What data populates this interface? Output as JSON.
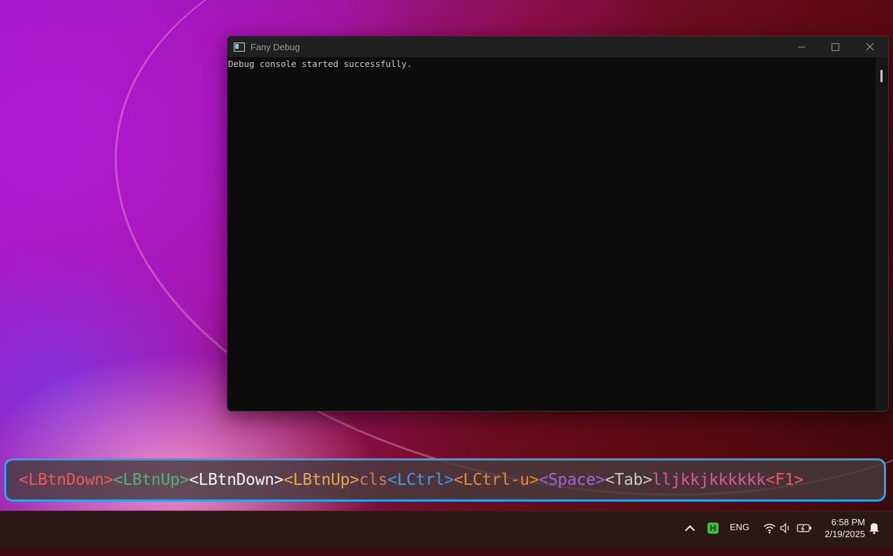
{
  "window": {
    "title": "Fany Debug",
    "console_lines": [
      "Debug console started successfully."
    ],
    "icons": {
      "minimize": "minimize-icon",
      "maximize": "maximize-icon",
      "close": "close-icon"
    }
  },
  "key_overlay": {
    "border_color": "#2aa6e6",
    "segments": [
      {
        "text": "<LBtnDown>",
        "color": "#e85a5a"
      },
      {
        "text": "<LBtnUp>",
        "color": "#52b07a"
      },
      {
        "text": "<LBtnDown>",
        "color": "#f2f2f2"
      },
      {
        "text": "<LBtnUp>",
        "color": "#e6a84a"
      },
      {
        "text": "cls",
        "color": "#d07a52"
      },
      {
        "text": "<LCtrl>",
        "color": "#3a9ee6"
      },
      {
        "text": "<LCtrl-u>",
        "color": "#e08a40"
      },
      {
        "text": "<Space>",
        "color": "#a066e0"
      },
      {
        "text": "<Tab>",
        "color": "#c8c8c8"
      },
      {
        "text": "lljkkjkkkkkk",
        "color": "#d85aa0"
      },
      {
        "text": "<F1>",
        "color": "#e85a5a"
      }
    ]
  },
  "taskbar": {
    "language": "ENG",
    "time": "6:58 PM",
    "date": "2/19/2025",
    "tray_app_letter": "H",
    "icons": [
      "chevron-up-icon",
      "wifi-icon",
      "volume-icon",
      "battery-icon",
      "notification-bell-icon"
    ]
  }
}
